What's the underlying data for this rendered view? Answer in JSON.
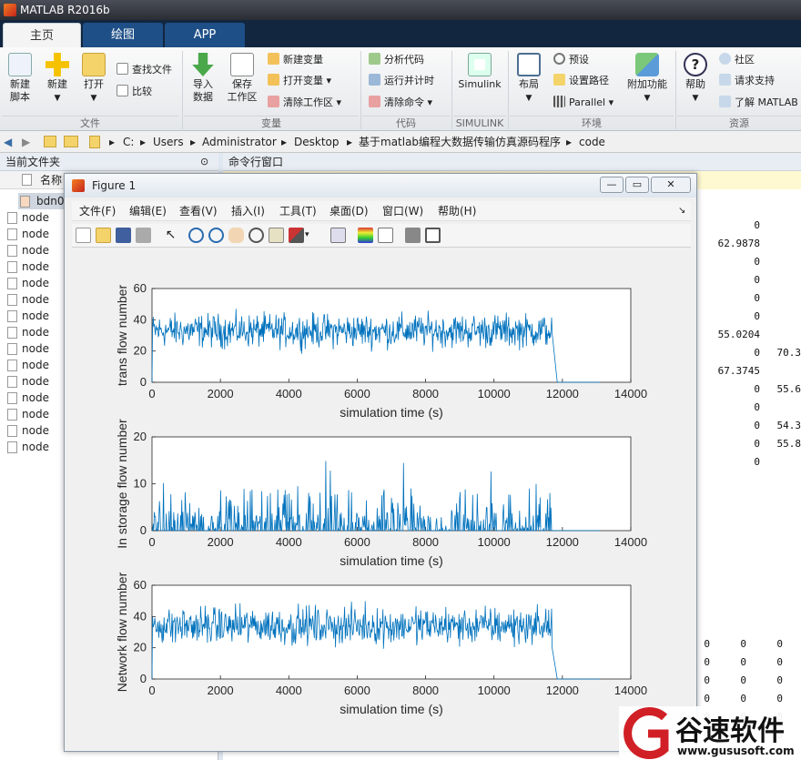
{
  "app": {
    "title": "MATLAB R2016b"
  },
  "tabs": [
    {
      "label": "主页"
    },
    {
      "label": "绘图"
    },
    {
      "label": "APP"
    }
  ],
  "ribbon": {
    "new_script": "新建\n脚本",
    "new": "新建",
    "open": "打开",
    "find_files": "查找文件",
    "compare": "比较",
    "import_data": "导入\n数据",
    "save_workspace": "保存\n工作区",
    "new_variable": "新建变量",
    "open_variable": "打开变量",
    "clear_workspace": "清除工作区",
    "analyze_code": "分析代码",
    "run_and_time": "运行并计时",
    "clear_commands": "清除命令",
    "simulink": "Simulink",
    "layout": "布局",
    "preferences": "预设",
    "set_path": "设置路径",
    "parallel": "Parallel",
    "addons": "附加功能",
    "help": "帮助",
    "community": "社区",
    "request_support": "请求支持",
    "learn_matlab": "了解 MATLAB",
    "groups": [
      "文件",
      "变量",
      "代码",
      "SIMULINK",
      "环境",
      "资源"
    ]
  },
  "address": {
    "crumbs": [
      "C:",
      "Users",
      "Administrator",
      "Desktop",
      "基于matlab编程大数据传输仿真源码程序",
      "code"
    ]
  },
  "current_folder": {
    "title": "当前文件夹",
    "col_name": "名称",
    "files": [
      "bdn0",
      "node",
      "node",
      "node",
      "node",
      "node",
      "node",
      "node",
      "node",
      "node",
      "node",
      "node",
      "node",
      "node",
      "node",
      "node"
    ]
  },
  "command_window": {
    "title": "命令行窗口",
    "values": [
      {
        "text": "0"
      },
      {
        "text": "62.9878"
      },
      {
        "text": "0"
      },
      {
        "text": "0"
      },
      {
        "text": "0"
      },
      {
        "text": "0"
      },
      {
        "text": "55.0204"
      },
      {
        "text": "0"
      },
      {
        "text": "70.3"
      },
      {
        "text": "67.3745"
      },
      {
        "text": "0"
      },
      {
        "text": "55.6"
      },
      {
        "text": "0"
      },
      {
        "text": "0"
      },
      {
        "text": "54.3"
      },
      {
        "text": "0"
      },
      {
        "text": "55.8"
      },
      {
        "text": "0"
      },
      {
        "text": "0"
      },
      {
        "text": "0"
      },
      {
        "text": "0"
      },
      {
        "text": "0"
      },
      {
        "text": "0"
      },
      {
        "text": "0"
      },
      {
        "text": "0"
      },
      {
        "text": "0"
      },
      {
        "text": "0"
      },
      {
        "text": "0"
      },
      {
        "text": "0"
      },
      {
        "text": "0"
      },
      {
        "text": "0"
      },
      {
        "text": "0"
      },
      {
        "text": "0"
      },
      {
        "text": "0"
      },
      {
        "text": "0"
      },
      {
        "text": "0"
      },
      {
        "text": "0"
      }
    ]
  },
  "figure": {
    "title": "Figure 1",
    "menu": [
      "文件(F)",
      "编辑(E)",
      "查看(V)",
      "插入(I)",
      "工具(T)",
      "桌面(D)",
      "窗口(W)",
      "帮助(H)"
    ]
  },
  "chart_data": [
    {
      "type": "line",
      "xlabel": "simulation time (s)",
      "ylabel": "trans flow number",
      "xlim": [
        0,
        14000
      ],
      "ylim": [
        0,
        60
      ],
      "xticks": [
        "0",
        "2000",
        "4000",
        "6000",
        "8000",
        "10000",
        "12000",
        "14000"
      ],
      "yticks": [
        "0",
        "20",
        "40",
        "60"
      ],
      "series": [
        {
          "color": "#0072bd",
          "mean": 33,
          "spread": 8,
          "end_x": 11700,
          "tail_end_x": 13100
        }
      ]
    },
    {
      "type": "line",
      "xlabel": "simulation time (s)",
      "ylabel": "In storage flow number",
      "xlim": [
        0,
        14000
      ],
      "ylim": [
        0,
        20
      ],
      "xticks": [
        "0",
        "2000",
        "4000",
        "6000",
        "8000",
        "10000",
        "12000",
        "14000"
      ],
      "yticks": [
        "0",
        "10",
        "20"
      ],
      "series": [
        {
          "color": "#0072bd",
          "mean": 1,
          "peak": 17,
          "end_x": 11700,
          "tail_end_x": 13100
        }
      ]
    },
    {
      "type": "line",
      "xlabel": "simulation time (s)",
      "ylabel": "Network flow number",
      "xlim": [
        0,
        14000
      ],
      "ylim": [
        0,
        60
      ],
      "xticks": [
        "0",
        "2000",
        "4000",
        "6000",
        "8000",
        "10000",
        "12000",
        "14000"
      ],
      "yticks": [
        "0",
        "20",
        "40",
        "60"
      ],
      "series": [
        {
          "color": "#0072bd",
          "mean": 34,
          "spread": 9,
          "end_x": 11700,
          "tail_end_x": 13100
        }
      ]
    }
  ],
  "watermark": {
    "brand": "谷速软件",
    "url": "www.gususoft.com"
  }
}
